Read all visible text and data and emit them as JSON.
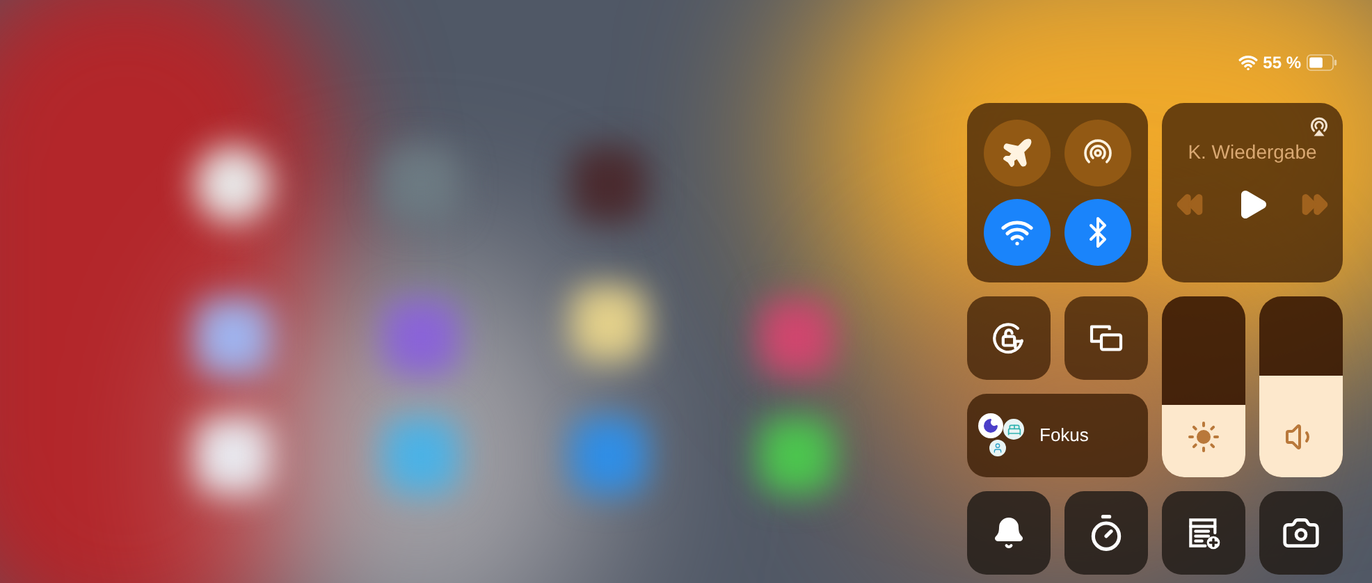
{
  "status_bar": {
    "battery": "55 %"
  },
  "connectivity": [
    {
      "kind": "airplane",
      "on": false
    },
    {
      "kind": "airdrop",
      "on": false
    },
    {
      "kind": "wifi",
      "on": true
    },
    {
      "kind": "bluetooth",
      "on": true
    }
  ],
  "now_playing": {
    "title": "K. Wiedergabe",
    "previous": {
      "disabled": true
    },
    "next": {
      "disabled": true
    }
  },
  "tiles": [
    {
      "kind": "rotation-lock"
    },
    {
      "kind": "screen-mirroring"
    }
  ],
  "focus": {
    "label": "Fokus"
  },
  "sliders": [
    {
      "kind": "brightness",
      "level": 0.4
    },
    {
      "kind": "volume",
      "level": 0.56
    }
  ],
  "bottom_tiles": [
    {
      "kind": "bell"
    },
    {
      "kind": "timer"
    },
    {
      "kind": "note-add"
    },
    {
      "kind": "camera"
    }
  ]
}
